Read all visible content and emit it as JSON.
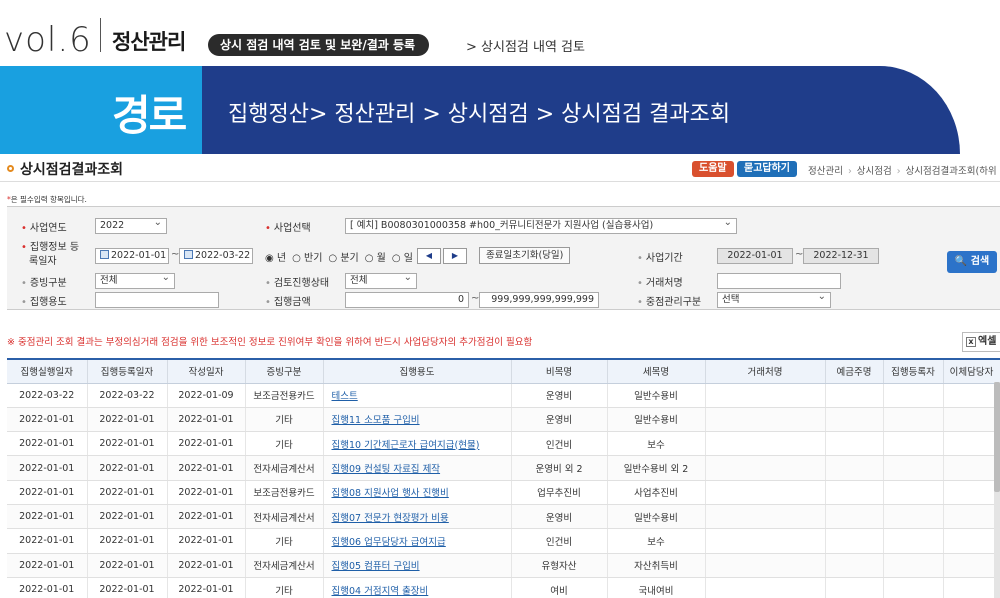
{
  "manual_header": {
    "vol": "vol.6",
    "section_title": "정산관리",
    "section_pill": "상시 점검 내역 검토 및 보완/결과 등록",
    "section_sub": "> 상시점검 내역 검토"
  },
  "path_banner": {
    "tag": "경로",
    "path": "집행정산> 정산관리 > 상시점검 > 상시점검 결과조회"
  },
  "page": {
    "title": "상시점검결과조회",
    "help_label": "도움말",
    "ask_label": "묻고답하기",
    "breadcrumb": [
      "정산관리",
      "상시점검",
      "상시점검결과조회(하위"
    ],
    "required_note_star": "*",
    "required_note": "은 필수입력 항목입니다."
  },
  "search": {
    "year_label": "사업연도",
    "year_value": "2022",
    "project_label": "사업선택",
    "project_value": "[   예치] B0080301000358 #h00_커뮤니티전문가 지원사업 (실습용사업)",
    "regdate_label_1": "집행정보 등",
    "regdate_label_2": "록일자",
    "date_from": "2022-01-01",
    "date_to": "2022-03-22",
    "tilde": "~",
    "radio_options": [
      "◉ 년",
      "○ 반기",
      "○ 분기",
      "○ 월",
      "○ 일"
    ],
    "prev_label": "◀",
    "next_label": "▶",
    "reset_label": "종료일초기화(당일)",
    "period_label": "사업기간",
    "period_from": "2022-01-01",
    "period_to": "2022-12-31",
    "evidence_label": "증빙구분",
    "evidence_value": "전체",
    "review_label": "검토진행상태",
    "review_value": "전체",
    "vendor_label": "거래처명",
    "vendor_value": "",
    "purpose_label": "집행용도",
    "purpose_value": "",
    "amount_label": "집행금액",
    "amount_from": "0",
    "amount_to": "999,999,999,999,999",
    "focus_label": "중점관리구분",
    "focus_value": "선택",
    "search_label": "검색",
    "search_icon": "magnifier"
  },
  "notice": "※ 중점관리 조회 결과는 부정의심거래 점검을 위한 보조적인 정보로 진위여부 확인을 위하여 반드시 사업담당자의 추가점검이 필요함",
  "excel_label": "엑셀",
  "table": {
    "columns": [
      "집행실행일자",
      "집행등록일자",
      "작성일자",
      "증빙구분",
      "집행용도",
      "비목명",
      "세목명",
      "거래처명",
      "예금주명",
      "집행등록자",
      "이체담당자"
    ],
    "rows": [
      [
        "2022-03-22",
        "2022-03-22",
        "2022-01-09",
        "보조금전용카드",
        "테스트",
        "운영비",
        "일반수용비",
        "",
        "",
        "",
        ""
      ],
      [
        "2022-01-01",
        "2022-01-01",
        "2022-01-01",
        "기타",
        "집행11 소모품 구입비",
        "운영비",
        "일반수용비",
        "",
        "",
        "",
        ""
      ],
      [
        "2022-01-01",
        "2022-01-01",
        "2022-01-01",
        "기타",
        "집행10 기간제근로자 급여지급(현물)",
        "인건비",
        "보수",
        "",
        "",
        "",
        ""
      ],
      [
        "2022-01-01",
        "2022-01-01",
        "2022-01-01",
        "전자세금계산서",
        "집행09 컨설팅 자료집 제작",
        "운영비 외 2",
        "일반수용비 외 2",
        "",
        "",
        "",
        ""
      ],
      [
        "2022-01-01",
        "2022-01-01",
        "2022-01-01",
        "보조금전용카드",
        "집행08 지원사업 행사 진행비",
        "업무추진비",
        "사업추진비",
        "",
        "",
        "",
        ""
      ],
      [
        "2022-01-01",
        "2022-01-01",
        "2022-01-01",
        "전자세금계산서",
        "집행07 전문가 현장평가 비용",
        "운영비",
        "일반수용비",
        "",
        "",
        "",
        ""
      ],
      [
        "2022-01-01",
        "2022-01-01",
        "2022-01-01",
        "기타",
        "집행06 업무담당자 급여지급",
        "인건비",
        "보수",
        "",
        "",
        "",
        ""
      ],
      [
        "2022-01-01",
        "2022-01-01",
        "2022-01-01",
        "전자세금계산서",
        "집행05 컴퓨터 구입비",
        "유형자산",
        "자산취득비",
        "",
        "",
        "",
        ""
      ],
      [
        "2022-01-01",
        "2022-01-01",
        "2022-01-01",
        "기타",
        "집행04 거점지역 출장비",
        "여비",
        "국내여비",
        "",
        "",
        "",
        ""
      ]
    ]
  }
}
